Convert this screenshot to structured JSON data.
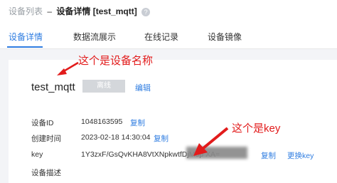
{
  "breadcrumb": {
    "parent": "设备列表",
    "separator": "–",
    "title": "设备详情 [test_mqtt]",
    "help_icon": "question-circle-icon"
  },
  "tabs": [
    {
      "label": "设备详情",
      "active": true
    },
    {
      "label": "数据流展示",
      "active": false
    },
    {
      "label": "在线记录",
      "active": false
    },
    {
      "label": "设备镜像",
      "active": false
    }
  ],
  "device": {
    "name": "test_mqtt",
    "status": "离线",
    "edit_label": "编辑"
  },
  "details": {
    "id_label": "设备ID",
    "id_value": "1048163595",
    "id_copy": "复制",
    "created_label": "创建时间",
    "created_value": "2023-02-18 14:30:04",
    "created_copy": "复制",
    "key_label": "key",
    "key_value": "1Y3zxF/GsQvKHA8VtXNpkwtfDjM8p                     XA=",
    "key_copy": "复制",
    "key_change": "更换key",
    "desc_label": "设备描述"
  },
  "annotations": {
    "name_note": "这个是设备名称",
    "key_note": "这个是key"
  },
  "colors": {
    "accent": "#2f7de1",
    "annotation": "#e21b1b",
    "status_offline": "#d4d7db"
  }
}
